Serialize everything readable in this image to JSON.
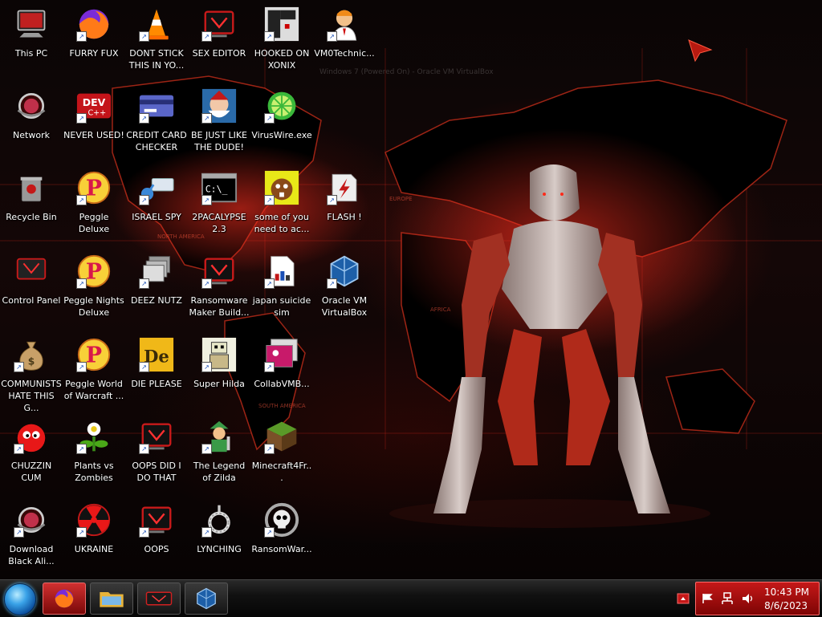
{
  "desktop": {
    "icons": [
      {
        "label": "This PC",
        "icon": "computer-icon"
      },
      {
        "label": "FURRY FUX",
        "icon": "firefox-icon"
      },
      {
        "label": "DONT STICK THIS IN YO...",
        "icon": "vlc-cone-icon"
      },
      {
        "label": "SEX EDITOR",
        "icon": "alienware-icon"
      },
      {
        "label": "HOOKED ON XONIX",
        "icon": "xonix-game-icon"
      },
      {
        "label": "VM0Technic...",
        "icon": "technician-icon"
      },
      {
        "label": "Network",
        "icon": "network-icon"
      },
      {
        "label": "NEVER USED!",
        "icon": "dev-cpp-icon"
      },
      {
        "label": "CREDIT CARD CHECKER",
        "icon": "credit-card-icon"
      },
      {
        "label": "BE JUST LIKE THE DUDE!",
        "icon": "santa-icon"
      },
      {
        "label": "VirusWire.exe",
        "icon": "limewire-icon"
      },
      {
        "label": "Recycle Bin",
        "icon": "recycle-bin-icon"
      },
      {
        "label": "Peggle Deluxe",
        "icon": "peggle-icon"
      },
      {
        "label": "ISRAEL SPY",
        "icon": "network-cable-icon"
      },
      {
        "label": "2PACALYPSE 2.3",
        "icon": "command-prompt-icon"
      },
      {
        "label": "some of you need to ac...",
        "icon": "beaver-icon"
      },
      {
        "label": "FLASH !",
        "icon": "flash-icon"
      },
      {
        "label": "Control Panel",
        "icon": "control-panel-icon"
      },
      {
        "label": "Peggle Nights Deluxe",
        "icon": "peggle-icon"
      },
      {
        "label": "DEEZ NUTZ",
        "icon": "windows-stack-icon"
      },
      {
        "label": "Ransomware Maker Build...",
        "icon": "alienware-icon"
      },
      {
        "label": "japan suicide sim",
        "icon": "document-icon"
      },
      {
        "label": "Oracle VM VirtualBox",
        "icon": "virtualbox-icon"
      },
      {
        "label": "COMMUNISTS HATE THIS G...",
        "icon": "money-bag-icon"
      },
      {
        "label": "Peggle World of Warcraft ...",
        "icon": "peggle-icon"
      },
      {
        "label": "DIE PLEASE",
        "icon": "de-app-icon"
      },
      {
        "label": "Super Hilda",
        "icon": "pixel-character-icon"
      },
      {
        "label": "CollabVMB...",
        "icon": "photos-icon"
      },
      {
        "label": "CHUZZIN CUM",
        "icon": "chuzzle-icon"
      },
      {
        "label": "Plants vs Zombies",
        "icon": "plant-icon"
      },
      {
        "label": "OOPS DID I DO THAT",
        "icon": "alienware-icon"
      },
      {
        "label": "The Legend of Zilda",
        "icon": "zelda-character-icon"
      },
      {
        "label": "Minecraft4Fr...",
        "icon": "minecraft-grass-icon"
      },
      {
        "label": "Download Black Ali...",
        "icon": "network-icon"
      },
      {
        "label": "UKRAINE",
        "icon": "radiation-icon"
      },
      {
        "label": "OOPS",
        "icon": "alienware-icon"
      },
      {
        "label": "LYNCHING",
        "icon": "rope-icon"
      },
      {
        "label": "RansomWar...",
        "icon": "skull-ring-icon"
      }
    ]
  },
  "wallpaper": {
    "labels": [
      "NORTH AMERICA",
      "EUROPE",
      "AFRICA",
      "SOUTH AMERICA"
    ],
    "faded_window_title": "Windows 7 (Powered On) - Oracle VM VirtualBox"
  },
  "taskbar": {
    "pinned": [
      {
        "name": "taskbar-firefox",
        "icon": "firefox-icon",
        "active": true
      },
      {
        "name": "taskbar-explorer",
        "icon": "folder-icon",
        "active": false
      },
      {
        "name": "taskbar-alienware",
        "icon": "alienware-icon",
        "active": false
      },
      {
        "name": "taskbar-virtualbox",
        "icon": "virtualbox-icon",
        "active": false
      }
    ],
    "tray": {
      "time": "10:43 PM",
      "date": "8/6/2023"
    }
  },
  "colors": {
    "accent": "#c51818",
    "taskbar": "#111111",
    "label_text": "#ffffff"
  }
}
